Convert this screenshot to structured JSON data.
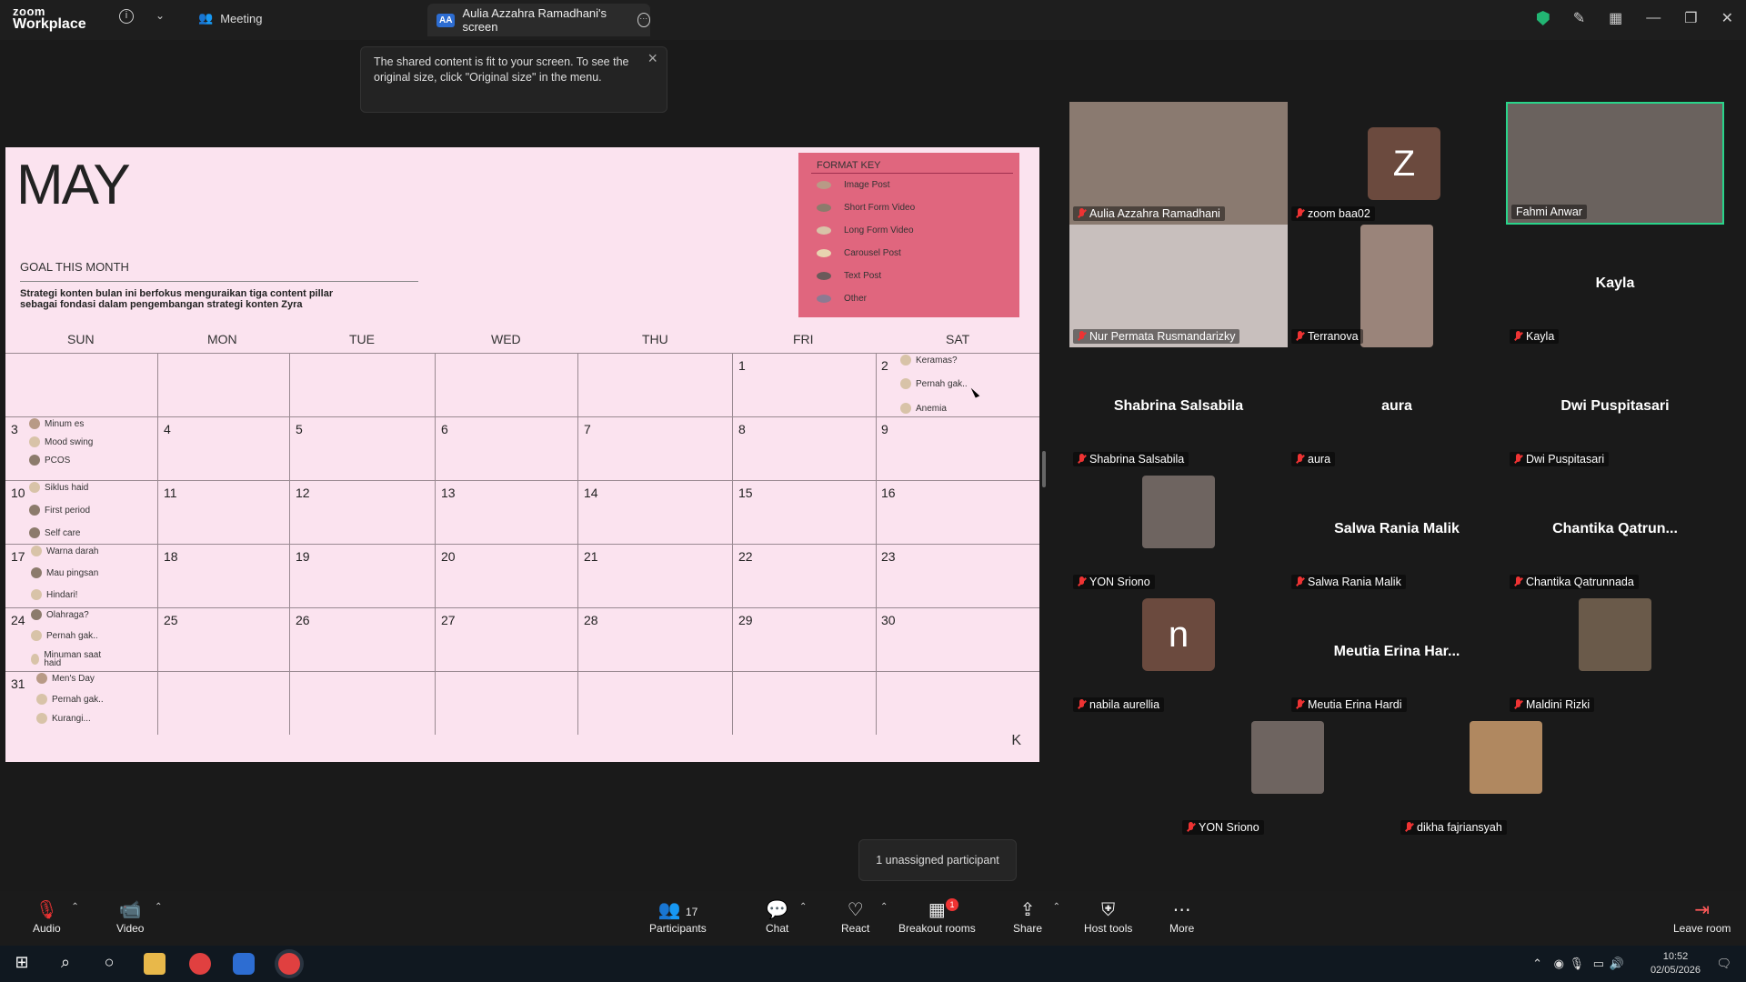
{
  "app": {
    "brand_top": "zoom",
    "brand_bottom": "Workplace"
  },
  "header": {
    "meeting_label": "Meeting",
    "share_tab_initials": "AA",
    "share_tab_label": "Aulia Azzahra Ramadhani's screen"
  },
  "tooltip": {
    "text": "The shared content is fit to your screen. To see the original size, click \"Original size\" in the menu."
  },
  "calendar": {
    "month": "MAY",
    "goal_title": "GOAL THIS MONTH",
    "goal_text": "Strategi konten bulan ini berfokus menguraikan tiga content pillar sebagai fondasi dalam pengembangan strategi konten Zyra",
    "format_key_title": "FORMAT KEY",
    "format_key": [
      {
        "label": "Image Post",
        "color": "#b89a86"
      },
      {
        "label": "Short Form Video",
        "color": "#8c7b6c"
      },
      {
        "label": "Long Form Video",
        "color": "#d8c3a8"
      },
      {
        "label": "Carousel Post",
        "color": "#e8d4b0"
      },
      {
        "label": "Text Post",
        "color": "#6a5a5a"
      },
      {
        "label": "Other",
        "color": "#8c7a92"
      }
    ],
    "weekdays": [
      "SUN",
      "MON",
      "TUE",
      "WED",
      "THU",
      "FRI",
      "SAT"
    ],
    "day_numbers": [
      "1",
      "2",
      "3",
      "4",
      "5",
      "6",
      "7",
      "8",
      "9",
      "10",
      "11",
      "12",
      "13",
      "14",
      "15",
      "16",
      "17",
      "18",
      "19",
      "20",
      "21",
      "22",
      "23",
      "24",
      "25",
      "26",
      "27",
      "28",
      "29",
      "30",
      "31"
    ],
    "events": {
      "d2": [
        "Keramas?",
        "Pernah gak..",
        "Anemia"
      ],
      "d3": [
        "Minum es",
        "Mood swing",
        "PCOS"
      ],
      "d10": [
        "Siklus haid",
        "First period",
        "Self care"
      ],
      "d17": [
        "Warna darah",
        "Mau pingsan",
        "Hindari!"
      ],
      "d24": [
        "Olahraga?",
        "Pernah gak..",
        "Minuman saat haid"
      ],
      "d31": [
        "Men's Day",
        "Pernah gak..",
        "Kurangi..."
      ]
    },
    "corner_mark": "K"
  },
  "participants": [
    {
      "name": "Aulia Azzahra Ramadhani",
      "video": true
    },
    {
      "name": "zoom baa02",
      "avatar": "Z"
    },
    {
      "name": "Fahmi Anwar",
      "video": true,
      "active_speaker": true
    },
    {
      "name": "Nur Permata Rusmandarizky",
      "video": true
    },
    {
      "name": "Terranova",
      "video": true
    },
    {
      "name": "Kayla",
      "display": "Kayla"
    },
    {
      "name": "Shabrina Salsabila",
      "display": "Shabrina Salsabila"
    },
    {
      "name": "aura",
      "display": "aura"
    },
    {
      "name": "Dwi Puspitasari",
      "display": "Dwi Puspitasari"
    },
    {
      "name": "YON Sriono",
      "video": true
    },
    {
      "name": "Salwa Rania Malik",
      "display": "Salwa Rania Malik"
    },
    {
      "name": "Chantika Qatrunnada",
      "display": "Chantika Qatrun..."
    },
    {
      "name": "nabila aurellia",
      "avatar": "n"
    },
    {
      "name": "Meutia Erina Hardi",
      "display": "Meutia Erina Har..."
    },
    {
      "name": "Maldini Rizki",
      "video": true
    },
    {
      "name": "YON Sriono",
      "video": true
    },
    {
      "name": "dikha fajriansyah",
      "video": true
    }
  ],
  "unassigned": "1 unassigned participant",
  "toolbar": {
    "audio": "Audio",
    "video": "Video",
    "participants": "Participants",
    "participants_count": "17",
    "chat": "Chat",
    "react": "React",
    "breakout": "Breakout rooms",
    "breakout_badge": "1",
    "share": "Share",
    "host_tools": "Host tools",
    "more": "More",
    "leave": "Leave room"
  },
  "taskbar": {
    "time": "10:52",
    "date": "02/05/2026"
  },
  "colors": {
    "active_speaker": "#29d48a",
    "muted": "#e33333",
    "slide_bg": "#fbe3ef",
    "format_key_bg": "#e0667e"
  }
}
